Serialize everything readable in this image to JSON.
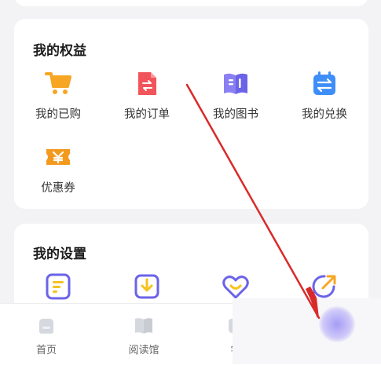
{
  "rights": {
    "title": "我的权益",
    "items": [
      {
        "label": "我的已购",
        "icon": "shopping-cart-icon"
      },
      {
        "label": "我的订单",
        "icon": "order-doc-icon"
      },
      {
        "label": "我的图书",
        "icon": "book-icon"
      },
      {
        "label": "我的兑换",
        "icon": "exchange-icon"
      },
      {
        "label": "优惠券",
        "icon": "coupon-icon"
      }
    ]
  },
  "settings": {
    "title": "我的设置",
    "items": [
      {
        "icon": "note-icon"
      },
      {
        "icon": "download-icon"
      },
      {
        "icon": "heart-icon"
      },
      {
        "icon": "share-icon"
      }
    ]
  },
  "tabbar": {
    "tabs": [
      {
        "label": "首页",
        "icon": "home-icon"
      },
      {
        "label": "阅读馆",
        "icon": "reading-hall-icon"
      },
      {
        "label": "学",
        "icon": "study-icon"
      }
    ]
  },
  "colors": {
    "accent_purple": "#6b63e8",
    "cart_orange": "#f6a623",
    "order_red": "#f1545a",
    "exchange_blue": "#3e8ef7",
    "coupon_orange": "#f39a1e",
    "annotation_red": "#d92a2a"
  }
}
